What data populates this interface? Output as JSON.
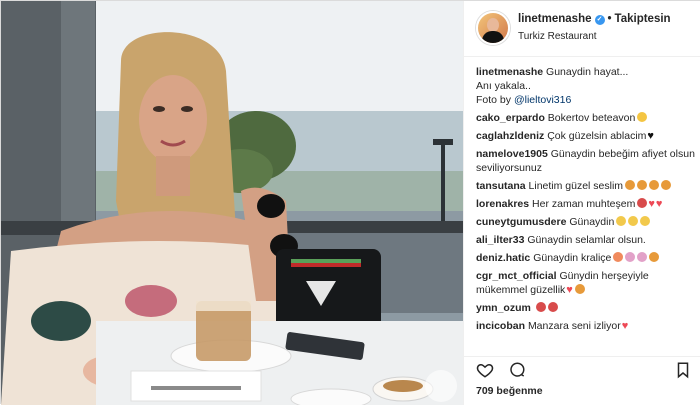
{
  "post": {
    "username": "linetmenashe",
    "follow_status": "Takiptesin",
    "location": "Turkiz Restaurant",
    "likes": "709 beğenme"
  },
  "caption": {
    "user": "linetmenashe",
    "line1": "Gunaydin hayat...",
    "line2": "Anı yakala..",
    "photo_by": "Foto by",
    "mention": "@lieltovi316"
  },
  "comments": [
    {
      "user": "cako_erpardo",
      "text": "Bokertov beteavon"
    },
    {
      "user": "caglahzldeniz",
      "text": "Çok güzelsin ablacim"
    },
    {
      "user": "namelove1905",
      "text": "Günaydin bebeğim afiyet olsun seviliyorsunuz"
    },
    {
      "user": "tansutana",
      "text": "Linetim güzel seslim"
    },
    {
      "user": "lorenakres",
      "text": "Her zaman muhteşem"
    },
    {
      "user": "cuneytgumusdere",
      "text": "Günaydin"
    },
    {
      "user": "ali_ilter33",
      "text": "Günaydin selamlar olsun."
    },
    {
      "user": "deniz.hatic",
      "text": "Günaydin kraliçe"
    },
    {
      "user": "cgr_mct_official",
      "text": "Günydin herşeyiyle mükemmel güzellik"
    },
    {
      "user": "ymn_ozum",
      "text": ""
    },
    {
      "user": "incicoban",
      "text": "Manzara seni izliyor"
    }
  ],
  "icons": [
    "verified-badge-icon",
    "heart-icon",
    "comment-icon",
    "bookmark-icon"
  ],
  "colors": {
    "link": "#003569",
    "verified": "#3897f0",
    "heart": "#ed4956"
  }
}
